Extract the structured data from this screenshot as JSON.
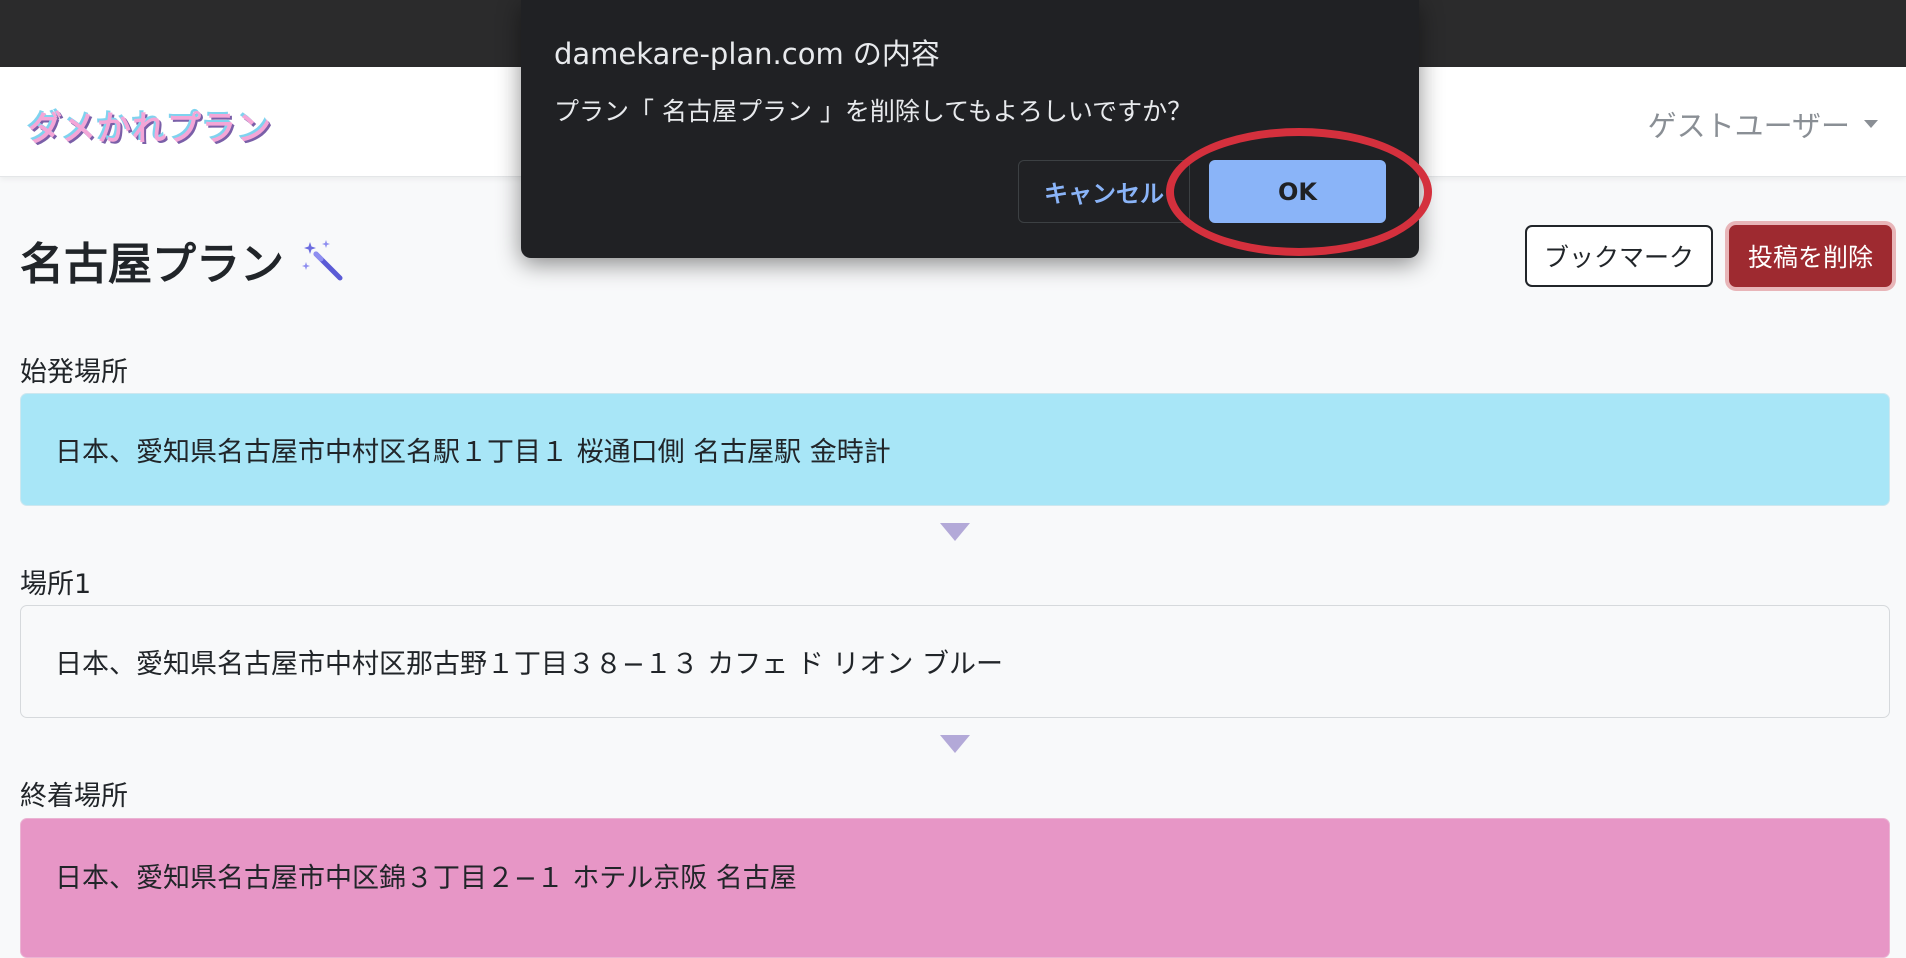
{
  "navbar": {
    "logo_text": "ダメかれプラン",
    "user_menu_label": "ゲストユーザー"
  },
  "plan": {
    "title": "名古屋プラン",
    "bookmark_label": "ブックマーク",
    "delete_label": "投稿を削除",
    "start": {
      "label": "始発場所",
      "address": "日本、愛知県名古屋市中村区名駅１丁目１ 桜通口側 名古屋駅 金時計"
    },
    "stop1": {
      "label": "場所1",
      "address": "日本、愛知県名古屋市中村区那古野１丁目３８−１３ カフェ ド リオン ブルー"
    },
    "end": {
      "label": "終着場所",
      "address": "日本、愛知県名古屋市中区錦３丁目２−１ ホテル京阪 名古屋"
    }
  },
  "dialog": {
    "title": "damekare-plan.com の内容",
    "message": "プラン「 名古屋プラン 」を削除してもよろしいですか？",
    "cancel_label": "キャンセル",
    "ok_label": "OK"
  },
  "colors": {
    "start_bg": "#a8e6f7",
    "end_bg": "#e796c6",
    "delete_btn": "#9e2a30",
    "ok_btn": "#8ab4f8",
    "highlight_ring": "#d4303d"
  },
  "icons": {
    "title_icon": "magic-wand-icon",
    "user_caret": "caret-down-icon",
    "flow_arrow": "triangle-down-icon"
  }
}
